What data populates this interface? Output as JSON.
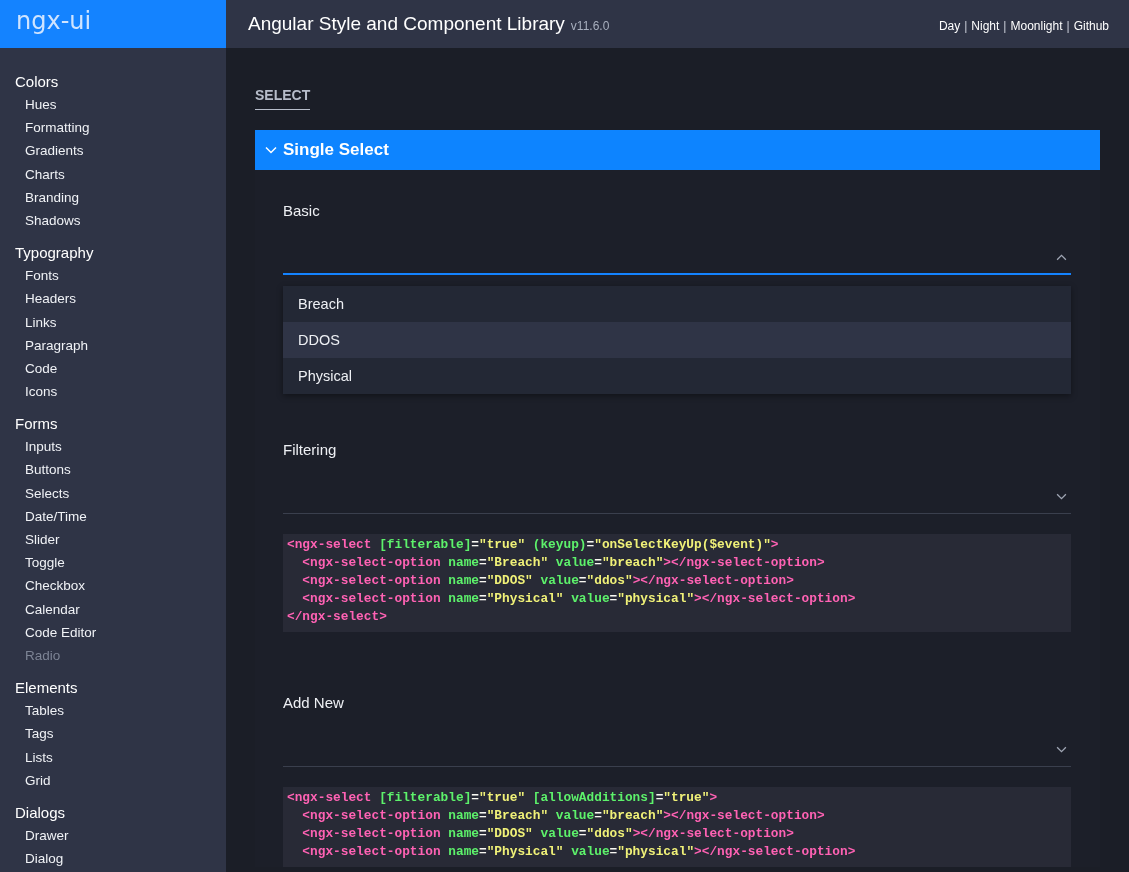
{
  "logo": "ngx-ui",
  "header": {
    "title": "Angular Style and Component Library",
    "version": "v11.6.0",
    "links": [
      "Day",
      "Night",
      "Moonlight",
      "Github"
    ],
    "separator": "|"
  },
  "sidebar": {
    "groups": [
      {
        "title": "Colors",
        "items": [
          {
            "label": "Hues",
            "disabled": false
          },
          {
            "label": "Formatting",
            "disabled": false
          },
          {
            "label": "Gradients",
            "disabled": false
          },
          {
            "label": "Charts",
            "disabled": false
          },
          {
            "label": "Branding",
            "disabled": false
          },
          {
            "label": "Shadows",
            "disabled": false
          }
        ]
      },
      {
        "title": "Typography",
        "items": [
          {
            "label": "Fonts",
            "disabled": false
          },
          {
            "label": "Headers",
            "disabled": false
          },
          {
            "label": "Links",
            "disabled": false
          },
          {
            "label": "Paragraph",
            "disabled": false
          },
          {
            "label": "Code",
            "disabled": false
          },
          {
            "label": "Icons",
            "disabled": false
          }
        ]
      },
      {
        "title": "Forms",
        "items": [
          {
            "label": "Inputs",
            "disabled": false
          },
          {
            "label": "Buttons",
            "disabled": false
          },
          {
            "label": "Selects",
            "disabled": false
          },
          {
            "label": "Date/Time",
            "disabled": false
          },
          {
            "label": "Slider",
            "disabled": false
          },
          {
            "label": "Toggle",
            "disabled": false
          },
          {
            "label": "Checkbox",
            "disabled": false
          },
          {
            "label": "Calendar",
            "disabled": false
          },
          {
            "label": "Code Editor",
            "disabled": false
          },
          {
            "label": "Radio",
            "disabled": true
          }
        ]
      },
      {
        "title": "Elements",
        "items": [
          {
            "label": "Tables",
            "disabled": false
          },
          {
            "label": "Tags",
            "disabled": false
          },
          {
            "label": "Lists",
            "disabled": false
          },
          {
            "label": "Grid",
            "disabled": false
          }
        ]
      },
      {
        "title": "Dialogs",
        "items": [
          {
            "label": "Drawer",
            "disabled": false
          },
          {
            "label": "Dialog",
            "disabled": false
          }
        ]
      }
    ]
  },
  "page_title": "SELECT",
  "section": {
    "title": "Single Select",
    "expanded": true,
    "demos": [
      {
        "label": "Basic",
        "expanded": true,
        "options": [
          {
            "label": "Breach",
            "highlighted": false
          },
          {
            "label": "DDOS",
            "highlighted": true
          },
          {
            "label": "Physical",
            "highlighted": false
          }
        ]
      },
      {
        "label": "Filtering",
        "expanded": false,
        "code": [
          [
            {
              "kind": "tag",
              "text": "<ngx-select "
            },
            {
              "kind": "attr",
              "text": "[filterable]"
            },
            {
              "kind": "punct",
              "text": "="
            },
            {
              "kind": "string",
              "text": "\"true\" "
            },
            {
              "kind": "attr",
              "text": "(keyup)"
            },
            {
              "kind": "punct",
              "text": "="
            },
            {
              "kind": "string",
              "text": "\"onSelectKeyUp($event)\""
            },
            {
              "kind": "tag",
              "text": ">"
            }
          ],
          [
            {
              "kind": "tag",
              "text": "  <ngx-select-option "
            },
            {
              "kind": "attr",
              "text": "name"
            },
            {
              "kind": "punct",
              "text": "="
            },
            {
              "kind": "string",
              "text": "\"Breach\" "
            },
            {
              "kind": "attr",
              "text": "value"
            },
            {
              "kind": "punct",
              "text": "="
            },
            {
              "kind": "string",
              "text": "\"breach\""
            },
            {
              "kind": "tag",
              "text": "></ngx-select-option>"
            }
          ],
          [
            {
              "kind": "tag",
              "text": "  <ngx-select-option "
            },
            {
              "kind": "attr",
              "text": "name"
            },
            {
              "kind": "punct",
              "text": "="
            },
            {
              "kind": "string",
              "text": "\"DDOS\" "
            },
            {
              "kind": "attr",
              "text": "value"
            },
            {
              "kind": "punct",
              "text": "="
            },
            {
              "kind": "string",
              "text": "\"ddos\""
            },
            {
              "kind": "tag",
              "text": "></ngx-select-option>"
            }
          ],
          [
            {
              "kind": "tag",
              "text": "  <ngx-select-option "
            },
            {
              "kind": "attr",
              "text": "name"
            },
            {
              "kind": "punct",
              "text": "="
            },
            {
              "kind": "string",
              "text": "\"Physical\" "
            },
            {
              "kind": "attr",
              "text": "value"
            },
            {
              "kind": "punct",
              "text": "="
            },
            {
              "kind": "string",
              "text": "\"physical\""
            },
            {
              "kind": "tag",
              "text": "></ngx-select-option>"
            }
          ],
          [
            {
              "kind": "tag",
              "text": "</ngx-select>"
            }
          ]
        ]
      },
      {
        "label": "Add New",
        "expanded": false,
        "code": [
          [
            {
              "kind": "tag",
              "text": "<ngx-select "
            },
            {
              "kind": "attr",
              "text": "[filterable]"
            },
            {
              "kind": "punct",
              "text": "="
            },
            {
              "kind": "string",
              "text": "\"true\" "
            },
            {
              "kind": "attr",
              "text": "[allowAdditions]"
            },
            {
              "kind": "punct",
              "text": "="
            },
            {
              "kind": "string",
              "text": "\"true\""
            },
            {
              "kind": "tag",
              "text": ">"
            }
          ],
          [
            {
              "kind": "tag",
              "text": "  <ngx-select-option "
            },
            {
              "kind": "attr",
              "text": "name"
            },
            {
              "kind": "punct",
              "text": "="
            },
            {
              "kind": "string",
              "text": "\"Breach\" "
            },
            {
              "kind": "attr",
              "text": "value"
            },
            {
              "kind": "punct",
              "text": "="
            },
            {
              "kind": "string",
              "text": "\"breach\""
            },
            {
              "kind": "tag",
              "text": "></ngx-select-option>"
            }
          ],
          [
            {
              "kind": "tag",
              "text": "  <ngx-select-option "
            },
            {
              "kind": "attr",
              "text": "name"
            },
            {
              "kind": "punct",
              "text": "="
            },
            {
              "kind": "string",
              "text": "\"DDOS\" "
            },
            {
              "kind": "attr",
              "text": "value"
            },
            {
              "kind": "punct",
              "text": "="
            },
            {
              "kind": "string",
              "text": "\"ddos\""
            },
            {
              "kind": "tag",
              "text": "></ngx-select-option>"
            }
          ],
          [
            {
              "kind": "tag",
              "text": "  <ngx-select-option "
            },
            {
              "kind": "attr",
              "text": "name"
            },
            {
              "kind": "punct",
              "text": "="
            },
            {
              "kind": "string",
              "text": "\"Physical\" "
            },
            {
              "kind": "attr",
              "text": "value"
            },
            {
              "kind": "punct",
              "text": "="
            },
            {
              "kind": "string",
              "text": "\"physical\""
            },
            {
              "kind": "tag",
              "text": "></ngx-select-option>"
            }
          ]
        ]
      }
    ]
  }
}
